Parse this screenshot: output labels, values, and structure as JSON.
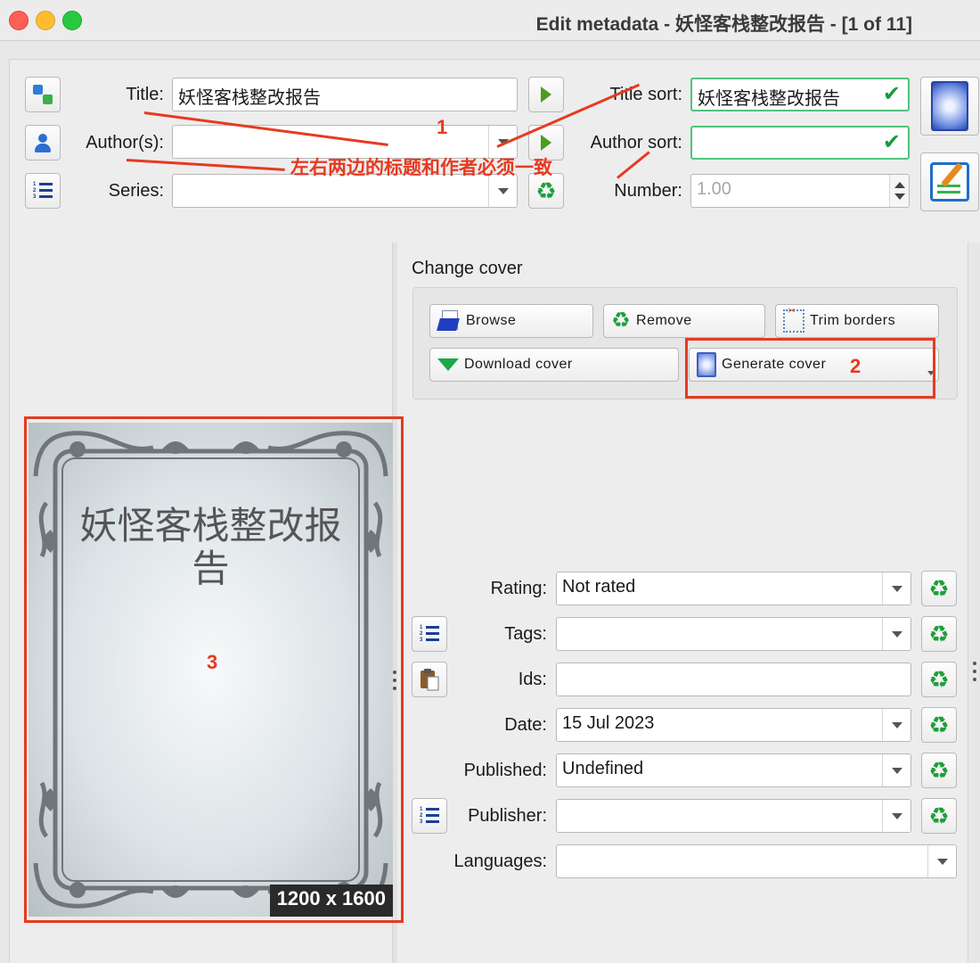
{
  "window": {
    "title": "Edit metadata - 妖怪客栈整改报告 - [1 of 11]"
  },
  "fields": {
    "title_label": "Title:",
    "title_value": "妖怪客栈整改报告",
    "title_sort_label": "Title sort:",
    "title_sort_value": "妖怪客栈整改报告",
    "authors_label": "Author(s):",
    "authors_value": "",
    "author_sort_label": "Author sort:",
    "author_sort_value": "",
    "series_label": "Series:",
    "series_value": "",
    "number_label": "Number:",
    "number_value": "1.00"
  },
  "annotations": {
    "marker_1": "1",
    "marker_1_note": "左右两边的标题和作者必须一致",
    "marker_2": "2",
    "marker_3": "3",
    "color": "#e63a20"
  },
  "cover_panel": {
    "heading": "Change cover",
    "buttons": {
      "browse": "Browse",
      "remove": "Remove",
      "trim": "Trim borders",
      "download": "Download cover",
      "generate": "Generate cover"
    }
  },
  "cover_preview": {
    "title_text": "妖怪客栈整改报告",
    "size_badge": "1200 x 1600"
  },
  "details": {
    "rating_label": "Rating:",
    "rating_value": "Not rated",
    "tags_label": "Tags:",
    "tags_value": "",
    "ids_label": "Ids:",
    "ids_value": "",
    "date_label": "Date:",
    "date_value": "15 Jul 2023",
    "published_label": "Published:",
    "published_value": "Undefined",
    "publisher_label": "Publisher:",
    "publisher_value": "",
    "languages_label": "Languages:",
    "languages_value": ""
  },
  "colors": {
    "accent_green": "#1e9e3a",
    "valid_border": "#52c27a"
  },
  "icons": [
    "swap-icon",
    "person-icon",
    "list-icon",
    "arrow-right-icon",
    "recycle-icon",
    "checkmark-icon",
    "cover-thumbnail-icon",
    "edit-metadata-icon",
    "folder-icon",
    "trim-icon",
    "download-arrow-icon",
    "generate-cover-icon",
    "clipboard-icon"
  ]
}
